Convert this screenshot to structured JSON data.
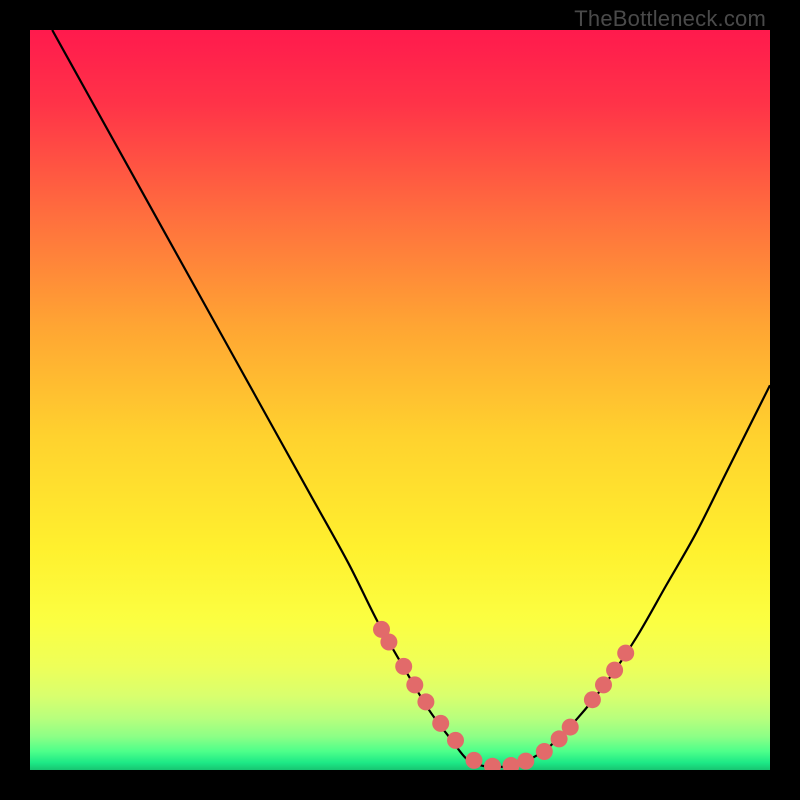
{
  "watermark": {
    "text": "TheBottleneck.com"
  },
  "colors": {
    "background": "#000000",
    "curve_stroke": "#000000",
    "marker_fill": "#e26a6a",
    "gradient_stops": [
      {
        "offset": 0.0,
        "color": "#ff1a4d"
      },
      {
        "offset": 0.1,
        "color": "#ff3348"
      },
      {
        "offset": 0.25,
        "color": "#ff6e3e"
      },
      {
        "offset": 0.4,
        "color": "#ffa533"
      },
      {
        "offset": 0.55,
        "color": "#ffd22e"
      },
      {
        "offset": 0.7,
        "color": "#fff02e"
      },
      {
        "offset": 0.8,
        "color": "#fbff42"
      },
      {
        "offset": 0.86,
        "color": "#eeff59"
      },
      {
        "offset": 0.9,
        "color": "#d9ff6e"
      },
      {
        "offset": 0.93,
        "color": "#b8ff7d"
      },
      {
        "offset": 0.955,
        "color": "#8cff86"
      },
      {
        "offset": 0.975,
        "color": "#4dff8a"
      },
      {
        "offset": 0.99,
        "color": "#1de986"
      },
      {
        "offset": 1.0,
        "color": "#17c571"
      }
    ]
  },
  "chart_data": {
    "type": "line",
    "title": "",
    "xlabel": "",
    "ylabel": "",
    "xlim": [
      0,
      100
    ],
    "ylim": [
      0,
      100
    ],
    "series": [
      {
        "name": "bottleneck-curve",
        "x": [
          3,
          8,
          13,
          18,
          23,
          28,
          33,
          38,
          43,
          47,
          51,
          54,
          57,
          59,
          61,
          63,
          65,
          67,
          70,
          74,
          78,
          82,
          86,
          90,
          94,
          98,
          100
        ],
        "y": [
          100,
          91,
          82,
          73,
          64,
          55,
          46,
          37,
          28,
          20,
          13,
          8,
          4,
          1.5,
          0.6,
          0.4,
          0.6,
          1.2,
          3,
          7,
          12,
          18,
          25,
          32,
          40,
          48,
          52
        ]
      }
    ],
    "markers": {
      "name": "highlighted-points",
      "x": [
        47.5,
        48.5,
        50.5,
        52,
        53.5,
        55.5,
        57.5,
        60,
        62.5,
        65,
        67,
        69.5,
        71.5,
        73,
        76,
        77.5,
        79,
        80.5
      ],
      "y": [
        19,
        17.3,
        14,
        11.5,
        9.2,
        6.3,
        4,
        1.3,
        0.5,
        0.6,
        1.2,
        2.5,
        4.2,
        5.8,
        9.5,
        11.5,
        13.5,
        15.8
      ]
    }
  }
}
